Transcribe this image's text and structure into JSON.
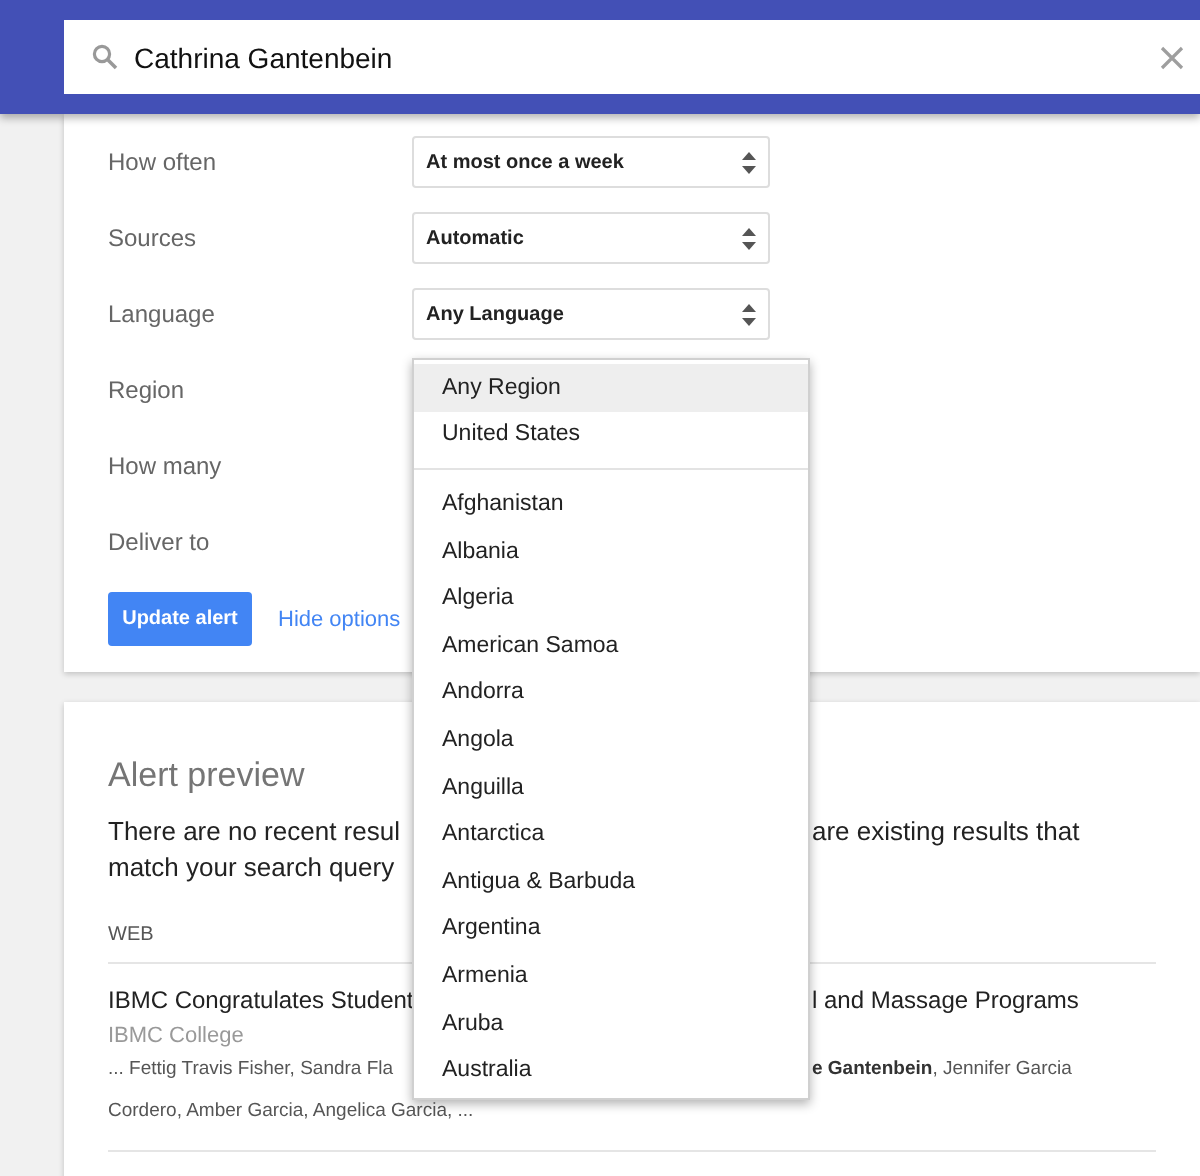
{
  "search": {
    "value": "Cathrina Gantenbein"
  },
  "options": [
    {
      "label": "How often",
      "kind": "select",
      "value": "At most once a week"
    },
    {
      "label": "Sources",
      "kind": "select",
      "value": "Automatic"
    },
    {
      "label": "Language",
      "kind": "select",
      "value": "Any Language"
    },
    {
      "label": "Region",
      "kind": "covered"
    },
    {
      "label": "How many",
      "kind": "covered"
    },
    {
      "label": "Deliver to",
      "kind": "covered"
    }
  ],
  "actions": {
    "button": "Update alert",
    "link": "Hide options"
  },
  "dropdown": {
    "groups": [
      [
        {
          "label": "Any Region",
          "selected": true
        },
        {
          "label": "United States",
          "selected": false
        }
      ],
      [
        {
          "label": "Afghanistan",
          "selected": false
        },
        {
          "label": "Albania",
          "selected": false
        },
        {
          "label": "Algeria",
          "selected": false
        },
        {
          "label": "American Samoa",
          "selected": false
        },
        {
          "label": "Andorra",
          "selected": false
        },
        {
          "label": "Angola",
          "selected": false
        },
        {
          "label": "Anguilla",
          "selected": false
        },
        {
          "label": "Antarctica",
          "selected": false
        },
        {
          "label": "Antigua & Barbuda",
          "selected": false
        },
        {
          "label": "Argentina",
          "selected": false
        },
        {
          "label": "Armenia",
          "selected": false
        },
        {
          "label": "Aruba",
          "selected": false
        },
        {
          "label": "Australia",
          "selected": false
        }
      ]
    ]
  },
  "preview": {
    "title": "Alert preview",
    "message_lines": [
      {
        "left": "There are no recent resul",
        "right": "are existing results that"
      },
      {
        "left": "match your search query"
      }
    ],
    "section": "WEB",
    "results": [
      {
        "title_left": "IBMC Congratulates Student",
        "title_right": "l and Massage Programs",
        "source": "IBMC College",
        "snippet_lines": [
          {
            "left": "... Fettig Travis Fisher, Sandra Fla",
            "right": "**e Gantenbein**, Jennifer Garcia"
          },
          {
            "left": "Cordero, Amber Garcia, Angelica Garcia, ..."
          }
        ]
      }
    ]
  }
}
